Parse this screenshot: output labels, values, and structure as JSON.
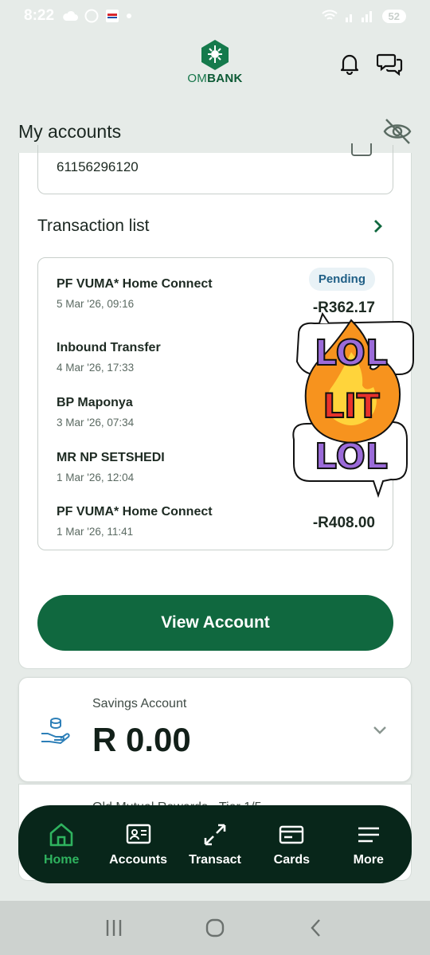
{
  "status_bar": {
    "time": "8:22",
    "battery": "52"
  },
  "header": {
    "brand_prefix": "OM",
    "brand_suffix": "BANK"
  },
  "page_title": "My accounts",
  "main_account": {
    "account_number": "61156296120",
    "transaction_heading": "Transaction list",
    "transactions": [
      {
        "name": "PF VUMA* Home Connect",
        "date": "5 Mar '26, 09:16",
        "amount": "-R362.17",
        "status": "Pending"
      },
      {
        "name": "Inbound Transfer",
        "date": "4 Mar '26, 17:33",
        "amount": ""
      },
      {
        "name": "BP Maponya",
        "date": "3 Mar '26, 07:34",
        "amount": ""
      },
      {
        "name": "MR NP SETSHEDI",
        "date": "1 Mar '26, 12:04",
        "amount": ""
      },
      {
        "name": "PF VUMA* Home Connect",
        "date": "1 Mar '26, 11:41",
        "amount": "-R408.00"
      }
    ],
    "view_button": "View Account"
  },
  "sticker": {
    "top": "LOL",
    "middle": "LIT",
    "bottom": "LOL"
  },
  "savings": {
    "label": "Savings Account",
    "amount": "R 0.00"
  },
  "third_account": {
    "label": "Old Mutual Rewards - Tier 1/5"
  },
  "nav": [
    {
      "label": "Home",
      "icon": "home-icon",
      "active": true
    },
    {
      "label": "Accounts",
      "icon": "accounts-icon",
      "active": false
    },
    {
      "label": "Transact",
      "icon": "transact-icon",
      "active": false
    },
    {
      "label": "Cards",
      "icon": "cards-icon",
      "active": false
    },
    {
      "label": "More",
      "icon": "menu-icon",
      "active": false
    }
  ],
  "colors": {
    "brand_green": "#10683f",
    "nav_bg": "#08261a",
    "nav_active": "#2fb35f",
    "pending_text": "#1f5f86"
  }
}
